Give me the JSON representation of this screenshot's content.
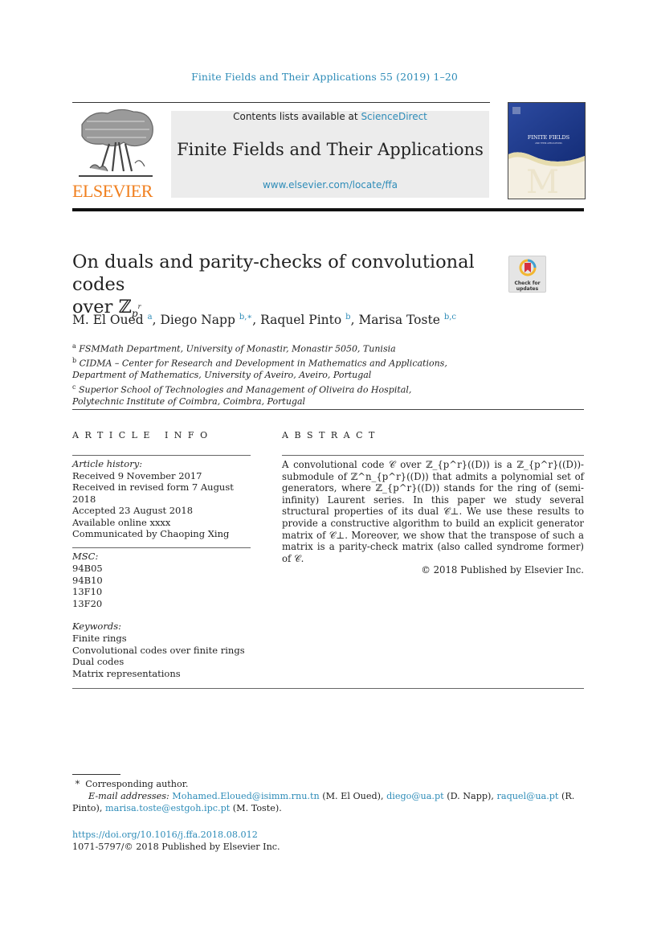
{
  "header": {
    "journal_reference": "Finite Fields and Their Applications 55 (2019) 1–20",
    "contents_prefix": "Contents lists available at ",
    "contents_link": "ScienceDirect",
    "journal_name": "Finite Fields and Their Applications",
    "journal_url": "www.elsevier.com/locate/ffa",
    "publisher_logo_text": "ELSEVIER",
    "cover_title": "FINITE FIELDS",
    "cover_subtitle": "AND THEIR APPLICATIONS"
  },
  "colors": {
    "link": "#2e8cb8",
    "elsevier_orange": "#f07f1e",
    "masthead_bg": "#ececec",
    "cover_blue": "#1e3a8c"
  },
  "article": {
    "title_line1": "On duals and parity-checks of convolutional codes",
    "title_line2_prefix": "over ",
    "title_math_symbol": "ℤ",
    "title_math_sub": "p",
    "title_math_sup": "r",
    "check_updates_line1": "Check for",
    "check_updates_line2": "updates",
    "authors": [
      {
        "name": "M. El Oued",
        "sup": "a"
      },
      {
        "name": "Diego Napp",
        "sup": "b,∗"
      },
      {
        "name": "Raquel Pinto",
        "sup": "b"
      },
      {
        "name": "Marisa Toste",
        "sup": "b,c"
      }
    ],
    "affiliations": [
      {
        "mark": "a",
        "text": "FSMMath Department, University of Monastir, Monastir 5050, Tunisia"
      },
      {
        "mark": "b",
        "text": "CIDMA – Center for Research and Development in Mathematics and Applications, Department of Mathematics, University of Aveiro, Aveiro, Portugal"
      },
      {
        "mark": "c",
        "text": "Superior School of Technologies and Management of Oliveira do Hospital, Polytechnic Institute of Coimbra, Coimbra, Portugal"
      }
    ]
  },
  "article_info": {
    "heading": "ARTICLE INFO",
    "history_label": "Article history:",
    "history": [
      "Received 9 November 2017",
      "Received in revised form 7 August 2018",
      "Accepted 23 August 2018",
      "Available online xxxx",
      "Communicated by Chaoping Xing"
    ],
    "msc_label": "MSC:",
    "msc": [
      "94B05",
      "94B10",
      "13F10",
      "13F20"
    ],
    "keywords_label": "Keywords:",
    "keywords": [
      "Finite rings",
      "Convolutional codes over finite rings",
      "Dual codes",
      "Matrix representations"
    ]
  },
  "abstract": {
    "heading": "ABSTRACT",
    "text": "A convolutional code 𝒞 over ℤ_{p^r}((D)) is a ℤ_{p^r}((D))-submodule of ℤ^n_{p^r}((D)) that admits a polynomial set of generators, where ℤ_{p^r}((D)) stands for the ring of (semi-infinity) Laurent series. In this paper we study several structural properties of its dual 𝒞⊥. We use these results to provide a constructive algorithm to build an explicit generator matrix of 𝒞⊥. Moreover, we show that the transpose of such a matrix is a parity-check matrix (also called syndrome former) of 𝒞.",
    "copyright": "© 2018 Published by Elsevier Inc."
  },
  "footnotes": {
    "corresponding": "Corresponding author.",
    "corresponding_mark": "*",
    "email_label": "E-mail addresses:",
    "emails": [
      {
        "address": "Mohamed.Eloued@isimm.rnu.tn",
        "owner": "(M. El Oued)"
      },
      {
        "address": "diego@ua.pt",
        "owner": "(D. Napp)"
      },
      {
        "address": "raquel@ua.pt",
        "owner": "(R. Pinto)"
      },
      {
        "address": "marisa.toste@estgoh.ipc.pt",
        "owner": "(M. Toste)"
      }
    ],
    "doi": "https://doi.org/10.1016/j.ffa.2018.08.012",
    "issn_line": "1071-5797/© 2018 Published by Elsevier Inc."
  }
}
